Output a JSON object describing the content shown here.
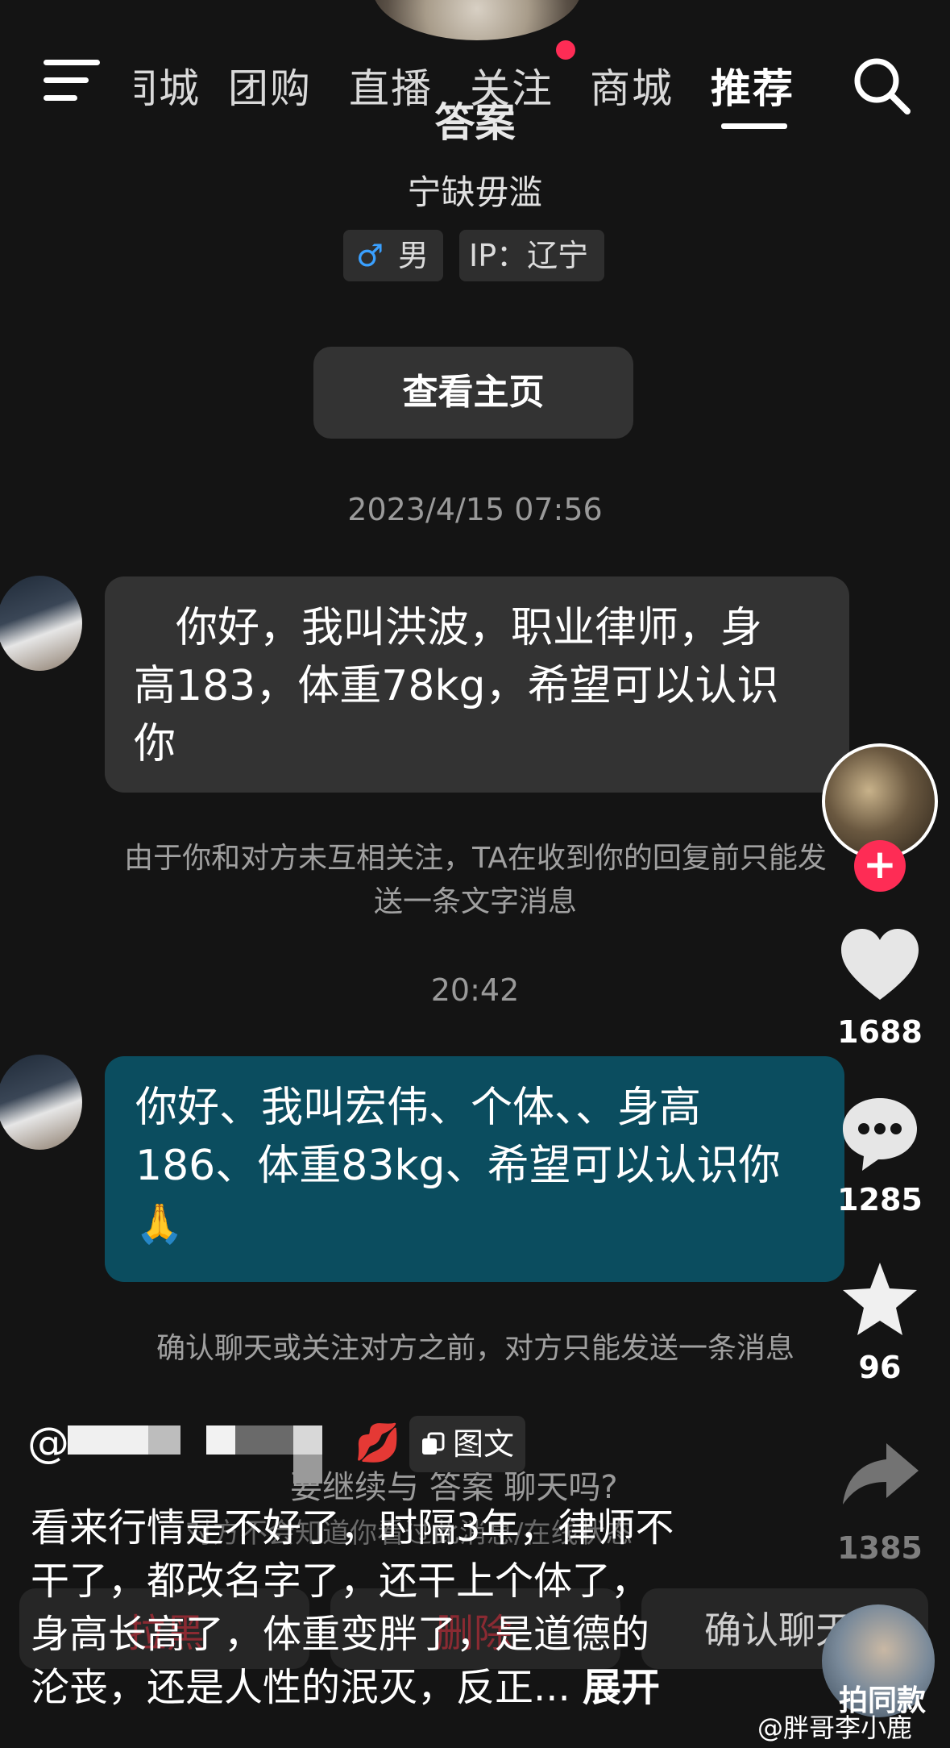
{
  "nav": {
    "tabs": [
      "同城",
      "团购",
      "直播",
      "关注",
      "商城",
      "推荐"
    ],
    "active_tab": "推荐",
    "menu_icon": "menu-icon",
    "search_icon": "search-icon",
    "notification_dot_color": "#fe2c55"
  },
  "profile": {
    "name": "答案",
    "bio": "宁缺毋滥",
    "gender_symbol": "♂",
    "gender": "男",
    "ip": "IP：辽宁",
    "view_button": "查看主页"
  },
  "messages": [
    {
      "timestamp": "2023/4/15 07:56",
      "lines": [
        "　你好，我叫洪波，职业律师，身",
        "高183，体重78kg，希望可以认识",
        "你"
      ],
      "notice_lines": [
        "由于你和对方未互相关注，TA在收到你的回复前只能发",
        "送一条文字消息"
      ]
    },
    {
      "timestamp": "20:42",
      "lines": [
        "你好、我叫宏伟、个体、、身高",
        "186、体重83kg、希望可以认识你"
      ],
      "emoji": "🙏",
      "notice": "确认聊天或关注对方之前，对方只能发送一条消息"
    }
  ],
  "rail": {
    "likes": "1688",
    "comments": "1285",
    "favorites": "96",
    "shares": "1385",
    "same_style": "拍同款"
  },
  "caption": {
    "at": "@",
    "kiss_emoji": "💋",
    "type_badge": "图文",
    "ghost_prompt": "要继续与 答案 聊天吗?",
    "ghost_subtext": "对方不会知道你看过此消息/在线状态",
    "ghost_buttons": [
      "拉黑",
      "删除",
      "确认聊天"
    ],
    "lines": [
      "看来行情是不好了，时隔3年，律师不",
      "干了，都改名字了，还干上个体了，",
      "身高长高了，体重变胖了，是道德的"
    ],
    "last_line": "沦丧，还是人性的泯灭，反正...",
    "expand": "展开"
  },
  "watermark": "@胖哥李小鹿",
  "colors": {
    "background": "#141414",
    "accent": "#fe2c55",
    "sent_bubble": "#0b4d5f",
    "received_bubble": "#333333"
  }
}
